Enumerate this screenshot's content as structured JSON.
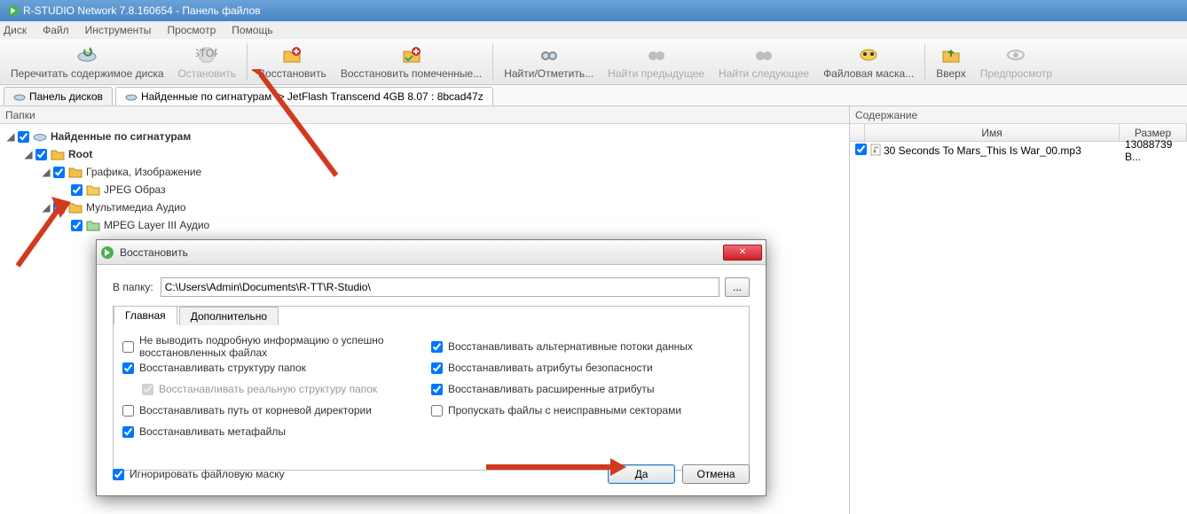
{
  "window": {
    "title": "R-STUDIO Network 7.8.160654 - Панель файлов"
  },
  "menubar": {
    "items": [
      "Диск",
      "Файл",
      "Инструменты",
      "Просмотр",
      "Помощь"
    ]
  },
  "toolbar": {
    "items": [
      {
        "label": "Перечитать содержимое диска",
        "disabled": false
      },
      {
        "label": "Остановить",
        "disabled": true
      },
      {
        "label": "Восстановить",
        "disabled": false
      },
      {
        "label": "Восстановить помеченные...",
        "disabled": false
      },
      {
        "label": "Найти/Отметить...",
        "disabled": false
      },
      {
        "label": "Найти предыдущее",
        "disabled": true
      },
      {
        "label": "Найти следующее",
        "disabled": true
      },
      {
        "label": "Файловая маска...",
        "disabled": false
      },
      {
        "label": "Вверх",
        "disabled": false
      },
      {
        "label": "Предпросмотр",
        "disabled": true
      }
    ]
  },
  "tabs": {
    "items": [
      {
        "label": "Панель дисков"
      },
      {
        "label": "Найденные по сигнатурам -> JetFlash Transcend 4GB 8.07 : 8bcad47z"
      }
    ]
  },
  "left_panel": {
    "header": "Папки",
    "tree": [
      {
        "indent": 0,
        "expanded": true,
        "checked": true,
        "label": "Найденные по сигнатурам",
        "bold": true,
        "icon": "disk"
      },
      {
        "indent": 1,
        "expanded": true,
        "checked": true,
        "label": "Root",
        "bold": true,
        "icon": "folder"
      },
      {
        "indent": 2,
        "expanded": true,
        "checked": true,
        "label": "Графика, Изображение",
        "icon": "folder"
      },
      {
        "indent": 3,
        "expanded": null,
        "checked": true,
        "label": "JPEG Образ",
        "icon": "folder-y"
      },
      {
        "indent": 2,
        "expanded": true,
        "checked": true,
        "label": "Мультимедиа Аудио",
        "icon": "folder"
      },
      {
        "indent": 3,
        "expanded": null,
        "checked": true,
        "label": "MPEG Layer III Аудио",
        "icon": "folder-g"
      }
    ]
  },
  "right_panel": {
    "header": "Содержание",
    "columns": {
      "name": "Имя",
      "size": "Размер"
    },
    "rows": [
      {
        "checked": true,
        "name": "30 Seconds To Mars_This Is War_00.mp3",
        "size": "13088739 B..."
      }
    ]
  },
  "dialog": {
    "title": "Восстановить",
    "path_label": "В папку:",
    "path_value": "C:\\Users\\Admin\\Documents\\R-TT\\R-Studio\\",
    "browse": "...",
    "tabs": {
      "main": "Главная",
      "extra": "Дополнительно"
    },
    "checks_left": [
      {
        "checked": false,
        "label": "Не выводить подробную информацию о успешно восстановленных файлах"
      },
      {
        "checked": true,
        "label": "Восстанавливать структуру папок"
      },
      {
        "checked": true,
        "label": "Восстанавливать реальную структуру папок",
        "indent": true,
        "disabled": true
      },
      {
        "checked": false,
        "label": "Восстанавливать путь от корневой директории"
      },
      {
        "checked": true,
        "label": "Восстанавливать метафайлы"
      }
    ],
    "checks_right": [
      {
        "checked": true,
        "label": "Восстанавливать альтернативные потоки данных"
      },
      {
        "checked": true,
        "label": "Восстанавливать атрибуты безопасности"
      },
      {
        "checked": true,
        "label": "Восстанавливать расширенные атрибуты"
      },
      {
        "checked": false,
        "label": "Пропускать файлы с неисправными секторами"
      }
    ],
    "ignore_mask": {
      "checked": true,
      "label": "Игнорировать файловую маску"
    },
    "ok": "Да",
    "cancel": "Отмена"
  }
}
